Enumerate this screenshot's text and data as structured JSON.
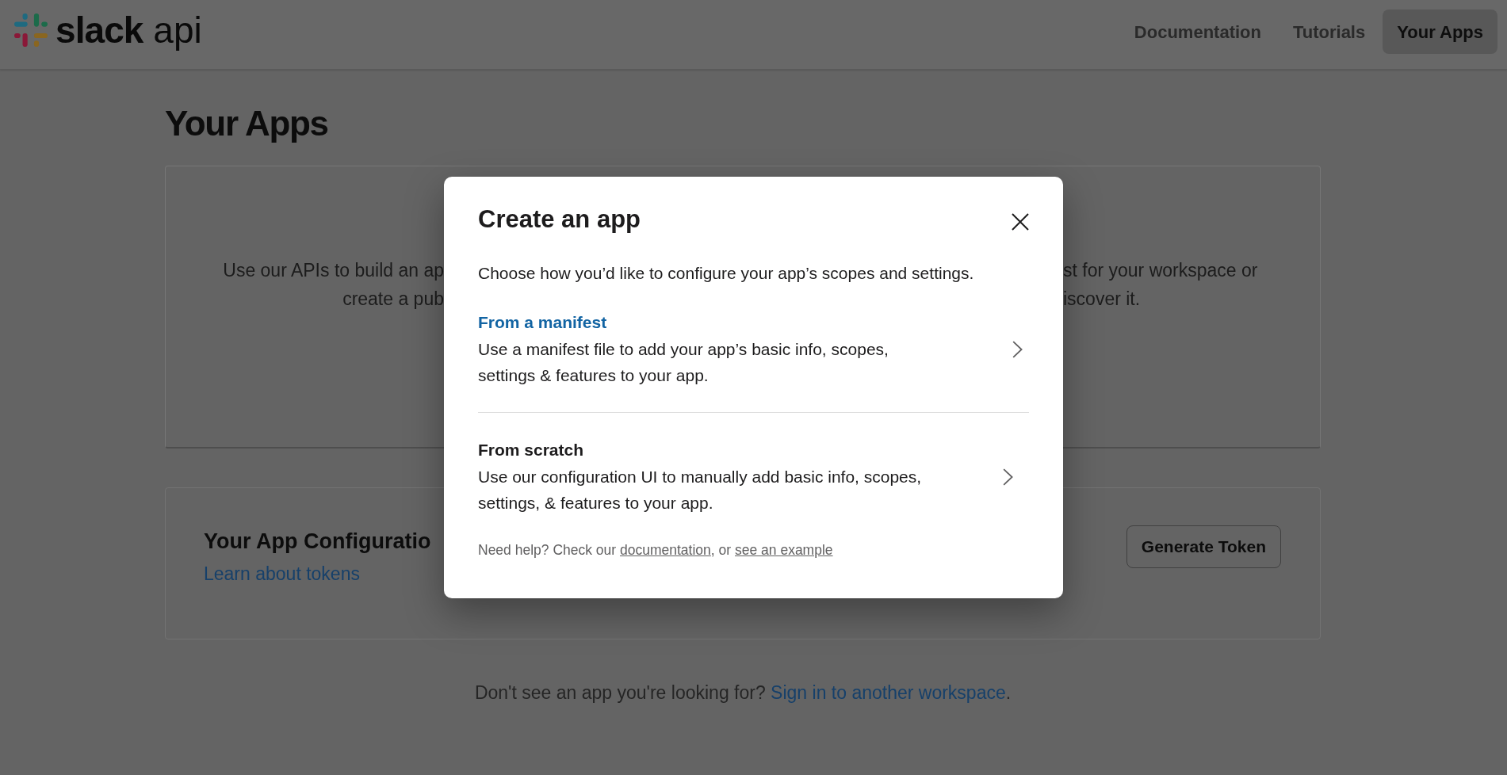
{
  "header": {
    "logo": {
      "wordmark": "slack",
      "suffix": "api"
    },
    "nav": [
      {
        "label": "Documentation",
        "selected": false
      },
      {
        "label": "Tutorials",
        "selected": false
      },
      {
        "label": "Your Apps",
        "selected": true
      }
    ]
  },
  "page": {
    "title": "Your Apps",
    "intro_card": {
      "lines": [
        {
          "left": "Use our APIs to build an ap",
          "right": "st for your workspace or"
        },
        {
          "left": "create a pub",
          "right": "iscover it."
        }
      ]
    },
    "tokens_card": {
      "title": "Your App Configuratio",
      "link": "Learn about tokens",
      "button": "Generate Token"
    },
    "footer": {
      "text": "Don't see an app you're looking for?",
      "link": "Sign in to another workspace",
      "suffix": "."
    }
  },
  "modal": {
    "title": "Create an app",
    "description": "Choose how you’d like to configure your app’s scopes and settings.",
    "options": [
      {
        "title": "From a manifest",
        "description": "Use a manifest file to add your app’s basic info, scopes, settings & features to your app.",
        "selected": true
      },
      {
        "title": "From scratch",
        "description": "Use our configuration UI to manually add basic info, scopes, settings, & features to your app.",
        "selected": false
      }
    ],
    "help": {
      "text": "Need help? Check our",
      "link": "documentation",
      "separator": ", or",
      "link_2": "see an example"
    }
  }
}
